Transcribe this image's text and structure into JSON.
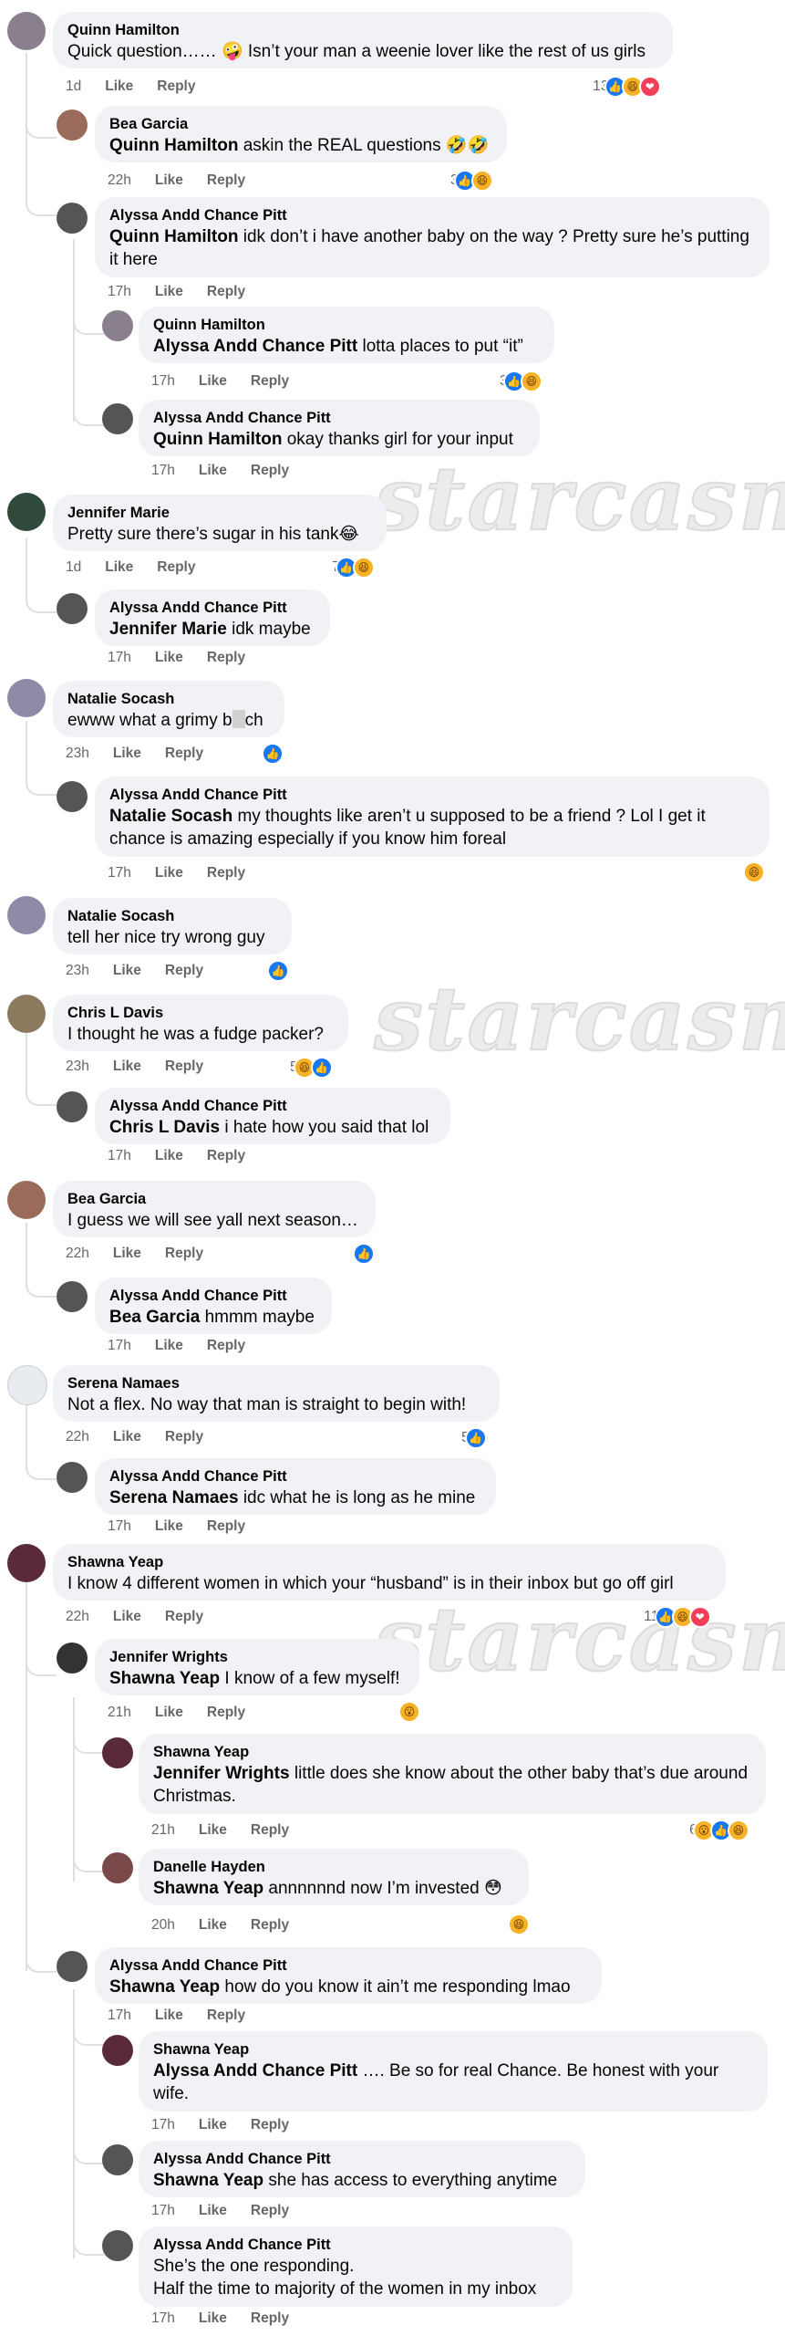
{
  "watermark": "starcasm",
  "comments": [
    {
      "id": "c1",
      "author": "Quinn Hamilton",
      "text": "Quick question…… 🤪 Isn’t your man a weenie lover like the rest of us girls",
      "time": "1d",
      "like": "Like",
      "reply": "Reply",
      "reaction_count": "13",
      "reactions": [
        "like",
        "haha",
        "love"
      ],
      "avatar_color": "#8a7f8c"
    },
    {
      "id": "c2",
      "author": "Bea Garcia",
      "mention": "Quinn Hamilton",
      "text": " askin the REAL questions 🤣🤣",
      "time": "22h",
      "like": "Like",
      "reply": "Reply",
      "reaction_count": "3",
      "reactions": [
        "like",
        "haha"
      ],
      "avatar_color": "#9a6b5b"
    },
    {
      "id": "c3",
      "author": "Alyssa Andd Chance Pitt",
      "mention": "Quinn Hamilton",
      "text": " idk don’t i have another baby on the way ? Pretty sure he’s putting it here",
      "time": "17h",
      "like": "Like",
      "reply": "Reply",
      "avatar_color": "#555555"
    },
    {
      "id": "c4",
      "author": "Quinn Hamilton",
      "mention": "Alyssa Andd Chance Pitt",
      "text": " lotta places to put “it”",
      "time": "17h",
      "like": "Like",
      "reply": "Reply",
      "reaction_count": "3",
      "reactions": [
        "like",
        "haha"
      ],
      "avatar_color": "#8a7f8c"
    },
    {
      "id": "c5",
      "author": "Alyssa Andd Chance Pitt",
      "mention": "Quinn Hamilton",
      "text": " okay thanks girl for your input",
      "time": "17h",
      "like": "Like",
      "reply": "Reply",
      "avatar_color": "#555555"
    },
    {
      "id": "c6",
      "author": "Jennifer Marie",
      "text": "Pretty sure there’s sugar in his tank😂",
      "time": "1d",
      "like": "Like",
      "reply": "Reply",
      "reaction_count": "7",
      "reactions": [
        "like",
        "haha"
      ],
      "avatar_color": "#2f4a3a"
    },
    {
      "id": "c7",
      "author": "Alyssa Andd Chance Pitt",
      "mention": "Jennifer Marie",
      "text": " idk maybe",
      "time": "17h",
      "like": "Like",
      "reply": "Reply",
      "avatar_color": "#555555"
    },
    {
      "id": "c8",
      "author": "Natalie Socash",
      "text_pre": "ewww what a grimy b",
      "text_post": "ch",
      "time": "23h",
      "like": "Like",
      "reply": "Reply",
      "reactions": [
        "like"
      ],
      "avatar_color": "#8f8aa6"
    },
    {
      "id": "c9",
      "author": "Alyssa Andd Chance Pitt",
      "mention": "Natalie Socash",
      "text": " my thoughts like aren’t u supposed to be a friend ? Lol I get it chance is amazing especially if you know him foreal",
      "time": "17h",
      "like": "Like",
      "reply": "Reply",
      "reactions": [
        "haha"
      ],
      "avatar_color": "#555555"
    },
    {
      "id": "c10",
      "author": "Natalie Socash",
      "text": "tell her nice try wrong guy",
      "time": "23h",
      "like": "Like",
      "reply": "Reply",
      "reactions": [
        "like"
      ],
      "avatar_color": "#8f8aa6"
    },
    {
      "id": "c11",
      "author": "Chris L Davis",
      "text": "I thought he was a fudge packer?",
      "time": "23h",
      "like": "Like",
      "reply": "Reply",
      "reaction_count": "5",
      "reactions": [
        "haha",
        "like"
      ],
      "avatar_color": "#8c7a5e"
    },
    {
      "id": "c12",
      "author": "Alyssa Andd Chance Pitt",
      "mention": "Chris L Davis",
      "text": " i hate how you said that lol",
      "time": "17h",
      "like": "Like",
      "reply": "Reply",
      "avatar_color": "#555555"
    },
    {
      "id": "c13",
      "author": "Bea Garcia",
      "text": "I guess we will see yall next season…",
      "time": "22h",
      "like": "Like",
      "reply": "Reply",
      "reactions": [
        "like"
      ],
      "avatar_color": "#9a6b5b"
    },
    {
      "id": "c14",
      "author": "Alyssa Andd Chance Pitt",
      "mention": "Bea Garcia",
      "text": " hmmm maybe",
      "time": "17h",
      "like": "Like",
      "reply": "Reply",
      "avatar_color": "#555555"
    },
    {
      "id": "c15",
      "author": "Serena Namaes",
      "text": "Not a flex. No way that man is straight to begin with!",
      "time": "22h",
      "like": "Like",
      "reply": "Reply",
      "reaction_count": "5",
      "reactions": [
        "like"
      ],
      "avatar_color": "#e8ecef"
    },
    {
      "id": "c16",
      "author": "Alyssa Andd Chance Pitt",
      "mention": "Serena Namaes",
      "text": " idc what he is long as he mine",
      "time": "17h",
      "like": "Like",
      "reply": "Reply",
      "avatar_color": "#555555"
    },
    {
      "id": "c17",
      "author": "Shawna Yeap",
      "text": "I know 4 different women in which your “husband” is in their inbox but go off girl",
      "time": "22h",
      "like": "Like",
      "reply": "Reply",
      "reaction_count": "11",
      "reactions": [
        "like",
        "haha",
        "love"
      ],
      "avatar_color": "#5a2a3a"
    },
    {
      "id": "c18",
      "author": "Jennifer Wrights",
      "mention": "Shawna Yeap",
      "text": " I know of a few myself!",
      "time": "21h",
      "like": "Like",
      "reply": "Reply",
      "reactions": [
        "wow"
      ],
      "avatar_color": "#333333"
    },
    {
      "id": "c19",
      "author": "Shawna Yeap",
      "mention": "Jennifer Wrights",
      "text": " little does she know about the other baby that’s due around Christmas.",
      "time": "21h",
      "like": "Like",
      "reply": "Reply",
      "reaction_count": "6",
      "reactions": [
        "wow",
        "like",
        "haha"
      ],
      "avatar_color": "#5a2a3a"
    },
    {
      "id": "c20",
      "author": "Danelle Hayden",
      "mention": "Shawna Yeap",
      "text": " annnnnnd now I’m invested 😳",
      "time": "20h",
      "like": "Like",
      "reply": "Reply",
      "reactions": [
        "haha"
      ],
      "avatar_color": "#7a4a4a"
    },
    {
      "id": "c21",
      "author": "Alyssa Andd Chance Pitt",
      "mention": "Shawna Yeap",
      "text": " how do you know it ain’t me responding lmao",
      "time": "17h",
      "like": "Like",
      "reply": "Reply",
      "avatar_color": "#555555"
    },
    {
      "id": "c22",
      "author": "Shawna Yeap",
      "mention": "Alyssa Andd Chance Pitt",
      "text": " …. Be so for real Chance. Be honest with your wife.",
      "time": "17h",
      "like": "Like",
      "reply": "Reply",
      "avatar_color": "#5a2a3a"
    },
    {
      "id": "c23",
      "author": "Alyssa Andd Chance Pitt",
      "mention": "Shawna Yeap",
      "text": " she has access to everything anytime",
      "time": "17h",
      "like": "Like",
      "reply": "Reply",
      "avatar_color": "#555555"
    },
    {
      "id": "c24",
      "author": "Alyssa Andd Chance Pitt",
      "text_l1": "She’s the one responding.",
      "text_l2": "Half the time to majority of the women in my inbox",
      "time": "17h",
      "like": "Like",
      "reply": "Reply",
      "avatar_color": "#555555"
    }
  ]
}
